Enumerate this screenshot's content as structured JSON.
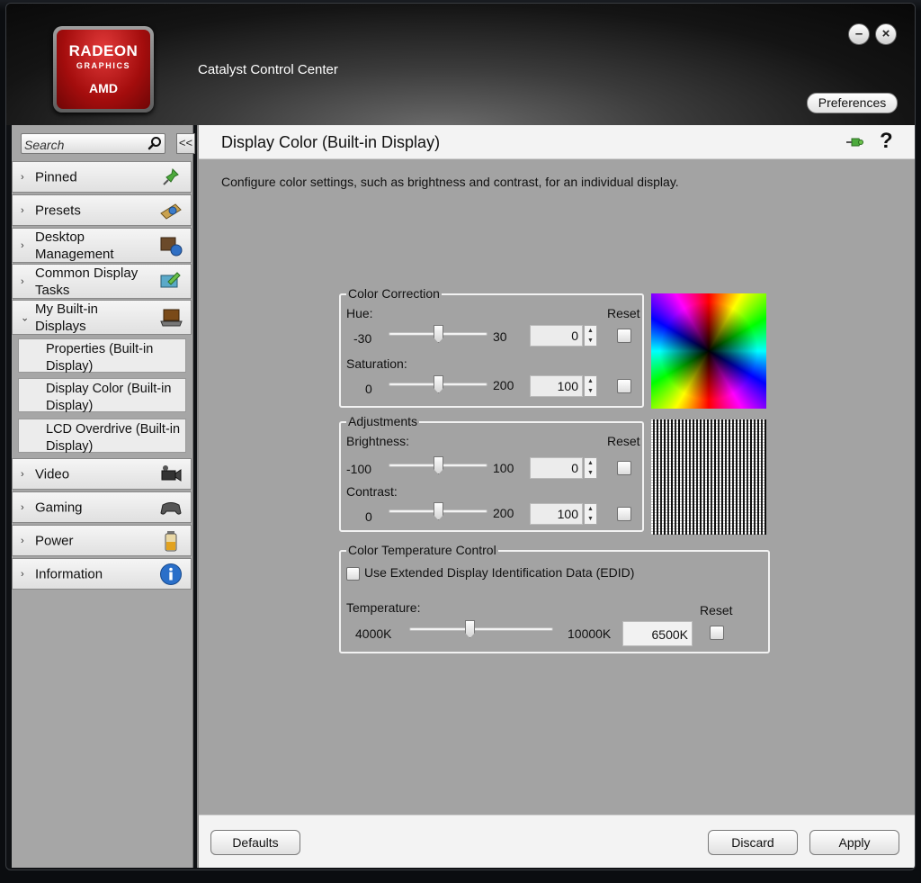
{
  "app": {
    "title": "Catalyst Control Center",
    "logo": {
      "main": "RADEON",
      "sub": "GRAPHICS",
      "brand": "AMD"
    },
    "window_buttons": {
      "minimize": "–",
      "close": "×"
    },
    "preferences_label": "Preferences"
  },
  "sidebar": {
    "search_placeholder": "Search",
    "collapse_label": "<<",
    "items": [
      {
        "label": "Pinned",
        "icon": "pin-icon",
        "chevron": "›"
      },
      {
        "label": "Presets",
        "icon": "presets-icon",
        "chevron": "›"
      },
      {
        "label": "Desktop Management",
        "icon": "desktop-management-icon",
        "chevron": "›"
      },
      {
        "label": "Common Display Tasks",
        "icon": "display-tasks-icon",
        "chevron": "›"
      },
      {
        "label": "My Built-in Displays",
        "icon": "laptop-icon",
        "chevron": "⌄"
      },
      {
        "label": "Video",
        "icon": "video-camera-icon",
        "chevron": "›"
      },
      {
        "label": "Gaming",
        "icon": "gamepad-icon",
        "chevron": "›"
      },
      {
        "label": "Power",
        "icon": "battery-icon",
        "chevron": "›"
      },
      {
        "label": "Information",
        "icon": "info-icon",
        "chevron": "›"
      }
    ],
    "sub_items": [
      {
        "label": "Properties (Built-in Display)"
      },
      {
        "label": "Display Color (Built-in Display)"
      },
      {
        "label": "LCD Overdrive (Built-in Display)"
      }
    ]
  },
  "main": {
    "title": "Display Color (Built-in Display)",
    "help": "?",
    "description": "Configure color settings, such as brightness and contrast, for an individual display.",
    "color_correction": {
      "title": "Color Correction",
      "reset_label": "Reset",
      "hue": {
        "label": "Hue:",
        "min": "-30",
        "max": "30",
        "value": "0",
        "level": 0.5
      },
      "saturation": {
        "label": "Saturation:",
        "min": "0",
        "max": "200",
        "value": "100",
        "level": 0.5
      }
    },
    "adjustments": {
      "title": "Adjustments",
      "reset_label": "Reset",
      "brightness": {
        "label": "Brightness:",
        "min": "-100",
        "max": "100",
        "value": "0",
        "level": 0.5
      },
      "contrast": {
        "label": "Contrast:",
        "min": "0",
        "max": "200",
        "value": "100",
        "level": 0.5
      }
    },
    "temperature": {
      "title": "Color Temperature Control",
      "edid_label": "Use Extended Display Identification Data (EDID)",
      "label": "Temperature:",
      "min": "4000K",
      "max": "10000K",
      "value": "6500K",
      "level": 0.417,
      "reset_label": "Reset"
    }
  },
  "footer": {
    "defaults_label": "Defaults",
    "discard_label": "Discard",
    "apply_label": "Apply"
  },
  "colors": {
    "header_bg": "#141414",
    "logo_red": "#a40d0d",
    "panel_bg": "#a3a3a3",
    "sidebar_bg": "#a6a6a6"
  }
}
